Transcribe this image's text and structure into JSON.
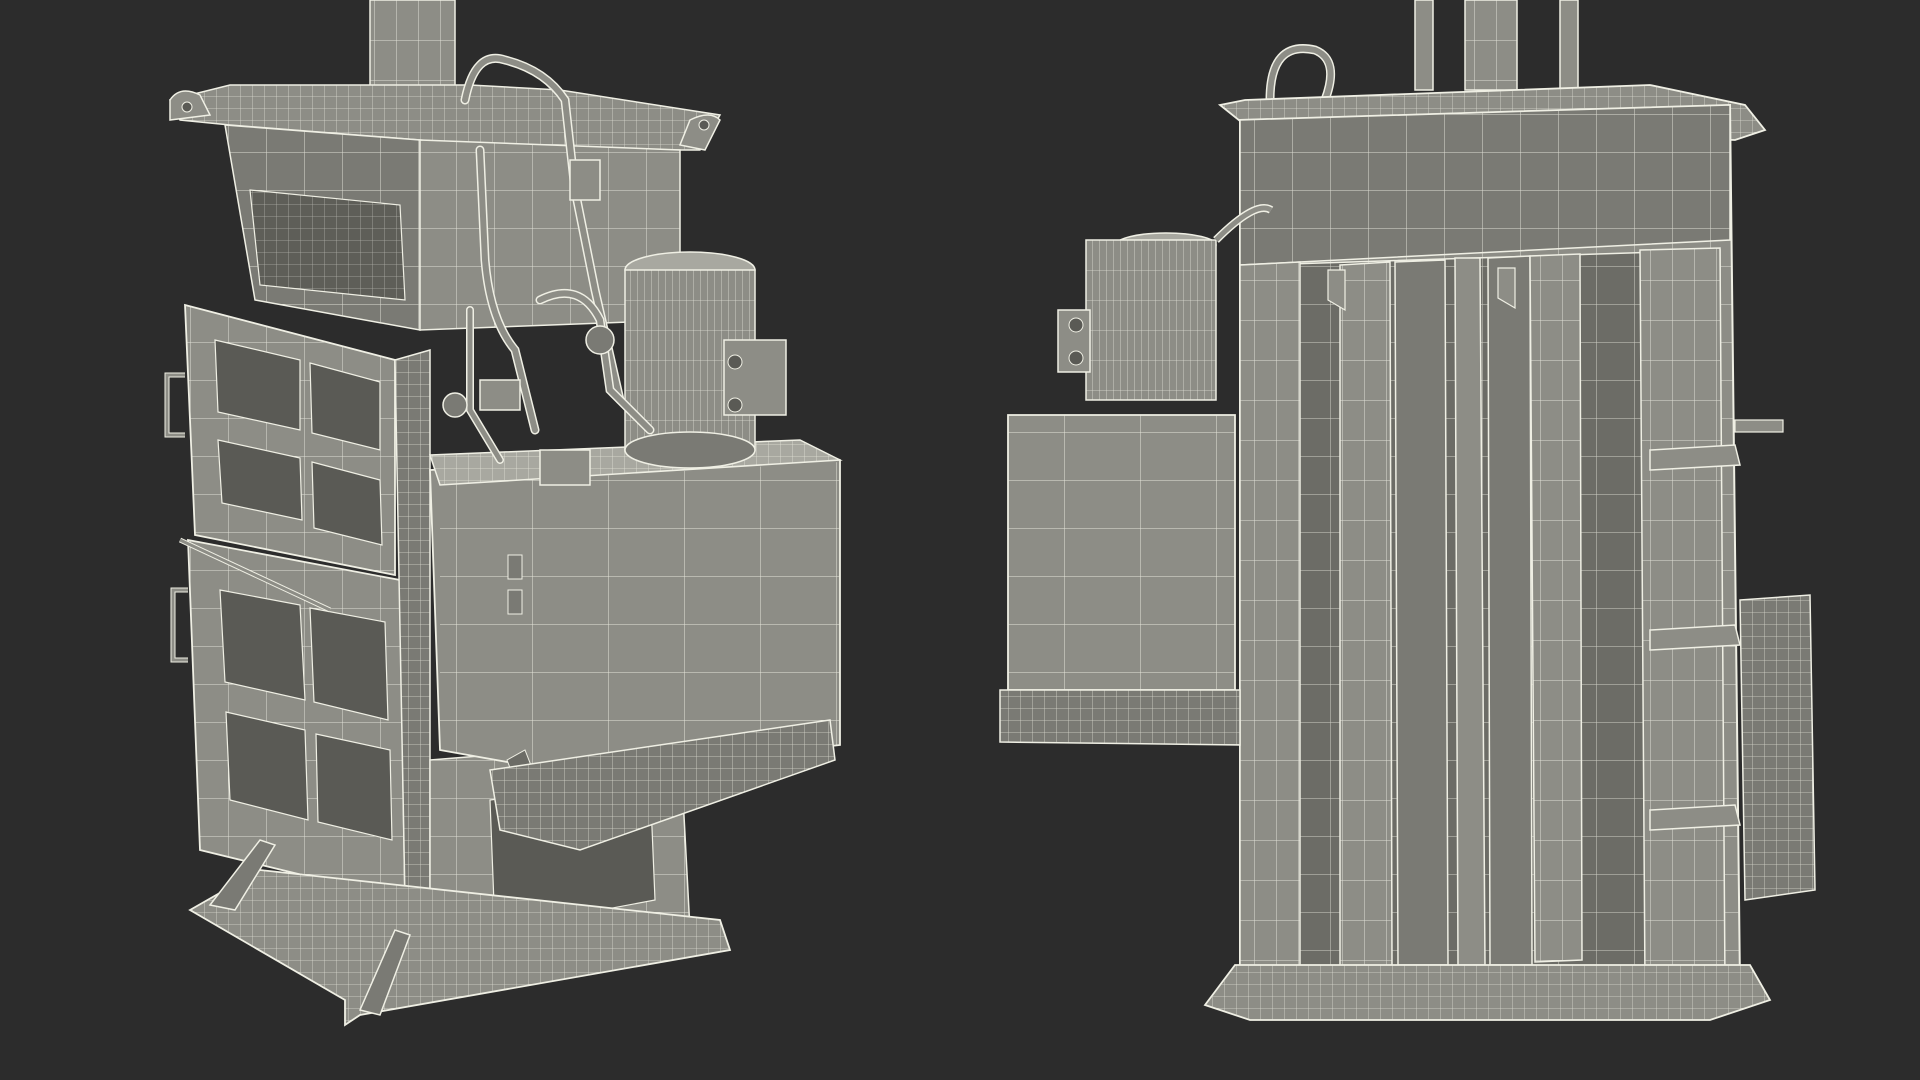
{
  "scene": {
    "background": "#2c2c2c",
    "subject": "vertical-baler-wireframe",
    "views": [
      "front-three-quarter",
      "rear"
    ],
    "colors": {
      "surface": "#8d8d86",
      "surface_light": "#a8a8a0",
      "surface_dark": "#6c6c66",
      "wire": "#efefe4",
      "shadow": "#4a4a45"
    }
  }
}
